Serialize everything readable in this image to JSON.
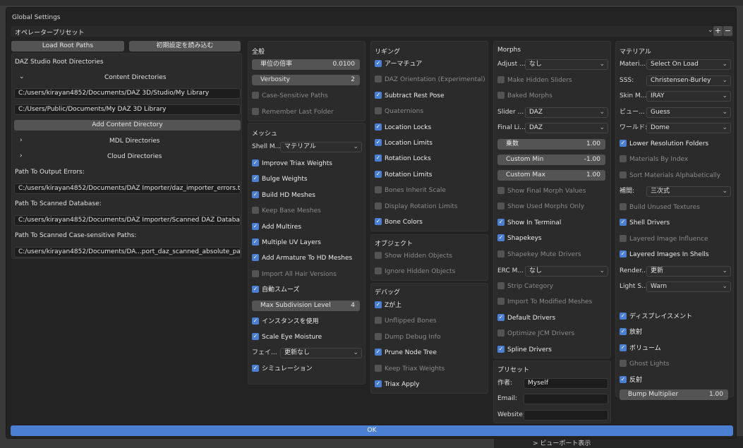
{
  "window": {
    "title": "Global Settings",
    "operator_preset": "オペレータープリセット",
    "ok_label": "OK"
  },
  "footer": {
    "viewport_label": "> ビューポート表示"
  },
  "icons": {
    "chevron_down": "chevron-down-icon",
    "chevron_right": "chevron-right-icon",
    "plus": "plus-icon",
    "minus": "minus-icon",
    "check": "check-icon"
  },
  "colors": {
    "accent": "#4a7fd3",
    "panel": "#2b2b2b",
    "dialog": "#232323"
  },
  "left": {
    "load_root_paths": "Load Root Paths",
    "load_defaults": "初期設定を読み込む",
    "root_dirs_title": "DAZ Studio Root Directories",
    "content_dirs": "Content Directories",
    "content_paths": [
      "C:/users/kirayan4852/Documents/DAZ 3D/Studio/My Library",
      "C:/Users/Public/Documents/My DAZ 3D Library"
    ],
    "add_content_dir": "Add Content Directory",
    "mdl_dirs": "MDL Directories",
    "cloud_dirs": "Cloud Directories",
    "output_errors_label": "Path To Output Errors:",
    "output_errors": "C:/users/kirayan4852/Documents/DAZ Importer/daz_importer_errors.txt",
    "scanned_db_label": "Path To Scanned Database:",
    "scanned_db": "C:/users/kirayan4852/Documents/DAZ Importer/Scanned DAZ Database",
    "scanned_case_label": "Path To Scanned Case-sensitive Paths:",
    "scanned_case": "C:/users/kirayan4852/Documents/DA...port_daz_scanned_absolute_paths.json"
  },
  "general": {
    "title": "全般",
    "scale_label": "単位の倍率",
    "scale_value": "0.0100",
    "verbosity_label": "Verbosity",
    "verbosity_value": "2",
    "checks": [
      {
        "label": "Case-Sensitive Paths",
        "on": false
      },
      {
        "label": "Remember Last Folder",
        "on": false
      }
    ]
  },
  "mesh": {
    "title": "メッシュ",
    "shell_label": "Shell M...",
    "shell_value": "マテリアル",
    "checks1": [
      {
        "label": "Improve Triax Weights",
        "on": true
      },
      {
        "label": "Bulge Weights",
        "on": true
      },
      {
        "label": "Build HD Meshes",
        "on": true
      },
      {
        "label": "Keep Base Meshes",
        "on": false
      },
      {
        "label": "Add Multires",
        "on": true
      },
      {
        "label": "Multiple UV Layers",
        "on": true
      },
      {
        "label": "Add Armature To HD Meshes",
        "on": true
      },
      {
        "label": "Import All Hair Versions",
        "on": false
      },
      {
        "label": "自動スムーズ",
        "on": true
      }
    ],
    "max_subdiv_label": "Max Subdivision Level",
    "max_subdiv_value": "4",
    "checks2": [
      {
        "label": "インスタンスを使用",
        "on": true
      },
      {
        "label": "Scale Eye Moisture",
        "on": true
      }
    ],
    "face_label": "フェイ...",
    "face_value": "更新なし",
    "checks3": [
      {
        "label": "シミュレーション",
        "on": true
      }
    ]
  },
  "rigging": {
    "title": "リギング",
    "checks": [
      {
        "label": "アーマチュア",
        "on": true
      },
      {
        "label": "DAZ Orientation (Experimental)",
        "on": false
      },
      {
        "label": "Subtract Rest Pose",
        "on": true
      },
      {
        "label": "Quaternions",
        "on": false
      },
      {
        "label": "Location Locks",
        "on": true
      },
      {
        "label": "Location Limits",
        "on": true
      },
      {
        "label": "Rotation Locks",
        "on": true
      },
      {
        "label": "Rotation Limits",
        "on": true
      },
      {
        "label": "Bones Inherit Scale",
        "on": false
      },
      {
        "label": "Display Rotation Limits",
        "on": false
      },
      {
        "label": "Bone Colors",
        "on": true
      }
    ]
  },
  "object": {
    "title": "オブジェクト",
    "checks": [
      {
        "label": "Show Hidden Objects",
        "on": false
      },
      {
        "label": "Ignore Hidden Objects",
        "on": false
      }
    ]
  },
  "debug": {
    "title": "デバッグ",
    "checks": [
      {
        "label": "Zが上",
        "on": true
      },
      {
        "label": "Unflipped Bones",
        "on": false
      },
      {
        "label": "Dump Debug Info",
        "on": false
      },
      {
        "label": "Prune Node Tree",
        "on": true
      },
      {
        "label": "Keep Triax Weights",
        "on": false
      },
      {
        "label": "Triax Apply",
        "on": true
      }
    ]
  },
  "morphs": {
    "title": "Morphs",
    "adjust_label": "Adjust ...",
    "adjust_value": "なし",
    "checks1": [
      {
        "label": "Make Hidden Sliders",
        "on": false
      },
      {
        "label": "Baked Morphs",
        "on": false
      }
    ],
    "slider_label": "Slider ...",
    "slider_value": "DAZ",
    "final_label": "Final Li...",
    "final_value": "DAZ",
    "mult_label": "乗数",
    "mult_value": "1.00",
    "cmin_label": "Custom Min",
    "cmin_value": "-1.00",
    "cmax_label": "Custom Max",
    "cmax_value": "1.00",
    "checks2": [
      {
        "label": "Show Final Morph Values",
        "on": false
      },
      {
        "label": "Show Used Morphs Only",
        "on": false
      },
      {
        "label": "Show In Terminal",
        "on": true
      },
      {
        "label": "Shapekeys",
        "on": true
      },
      {
        "label": "Shapekey Mute Drivers",
        "on": false
      }
    ],
    "erc_label": "ERC M...",
    "erc_value": "なし",
    "checks3": [
      {
        "label": "Strip Category",
        "on": false
      },
      {
        "label": "Import To Modified Meshes",
        "on": false
      },
      {
        "label": "Default Drivers",
        "on": true
      },
      {
        "label": "Optimize JCM Drivers",
        "on": false
      },
      {
        "label": "Spline Drivers",
        "on": true
      }
    ]
  },
  "preset": {
    "title": "プリセット",
    "author_label": "作者:",
    "author_value": "Myself",
    "email_label": "Email:",
    "email_value": "",
    "website_label": "Website:",
    "website_value": ""
  },
  "material": {
    "title": "マテリアル",
    "mat_label": "Materi...",
    "mat_value": "Select On Load",
    "sss_label": "SSS:",
    "sss_value": "Christensen-Burley",
    "skin_label": "Skin M...",
    "skin_value": "IRAY",
    "view_label": "ビュー...",
    "view_value": "Guess",
    "world_label": "ワールド:",
    "world_value": "Dome",
    "checks1": [
      {
        "label": "Lower Resolution Folders",
        "on": true
      },
      {
        "label": "Materials By Index",
        "on": false
      },
      {
        "label": "Sort Materials Alphabetically",
        "on": false
      }
    ],
    "interp_label": "補間:",
    "interp_value": "三次式",
    "checks2": [
      {
        "label": "Build Unused Textures",
        "on": false
      },
      {
        "label": "Shell Drivers",
        "on": true
      },
      {
        "label": "Layered Image Influence",
        "on": false
      },
      {
        "label": "Layered Images In Shells",
        "on": true
      }
    ],
    "render_label": "Render...",
    "render_value": "更新",
    "light_label": "Light S...",
    "light_value": "Warn",
    "checks3": [
      {
        "label": "ディスプレイスメント",
        "on": true
      },
      {
        "label": "放射",
        "on": true
      },
      {
        "label": "ボリューム",
        "on": true
      },
      {
        "label": "Ghost Lights",
        "on": false
      },
      {
        "label": "反射",
        "on": true
      }
    ],
    "bump_label": "Bump Multiplier",
    "bump_value": "1.00"
  }
}
